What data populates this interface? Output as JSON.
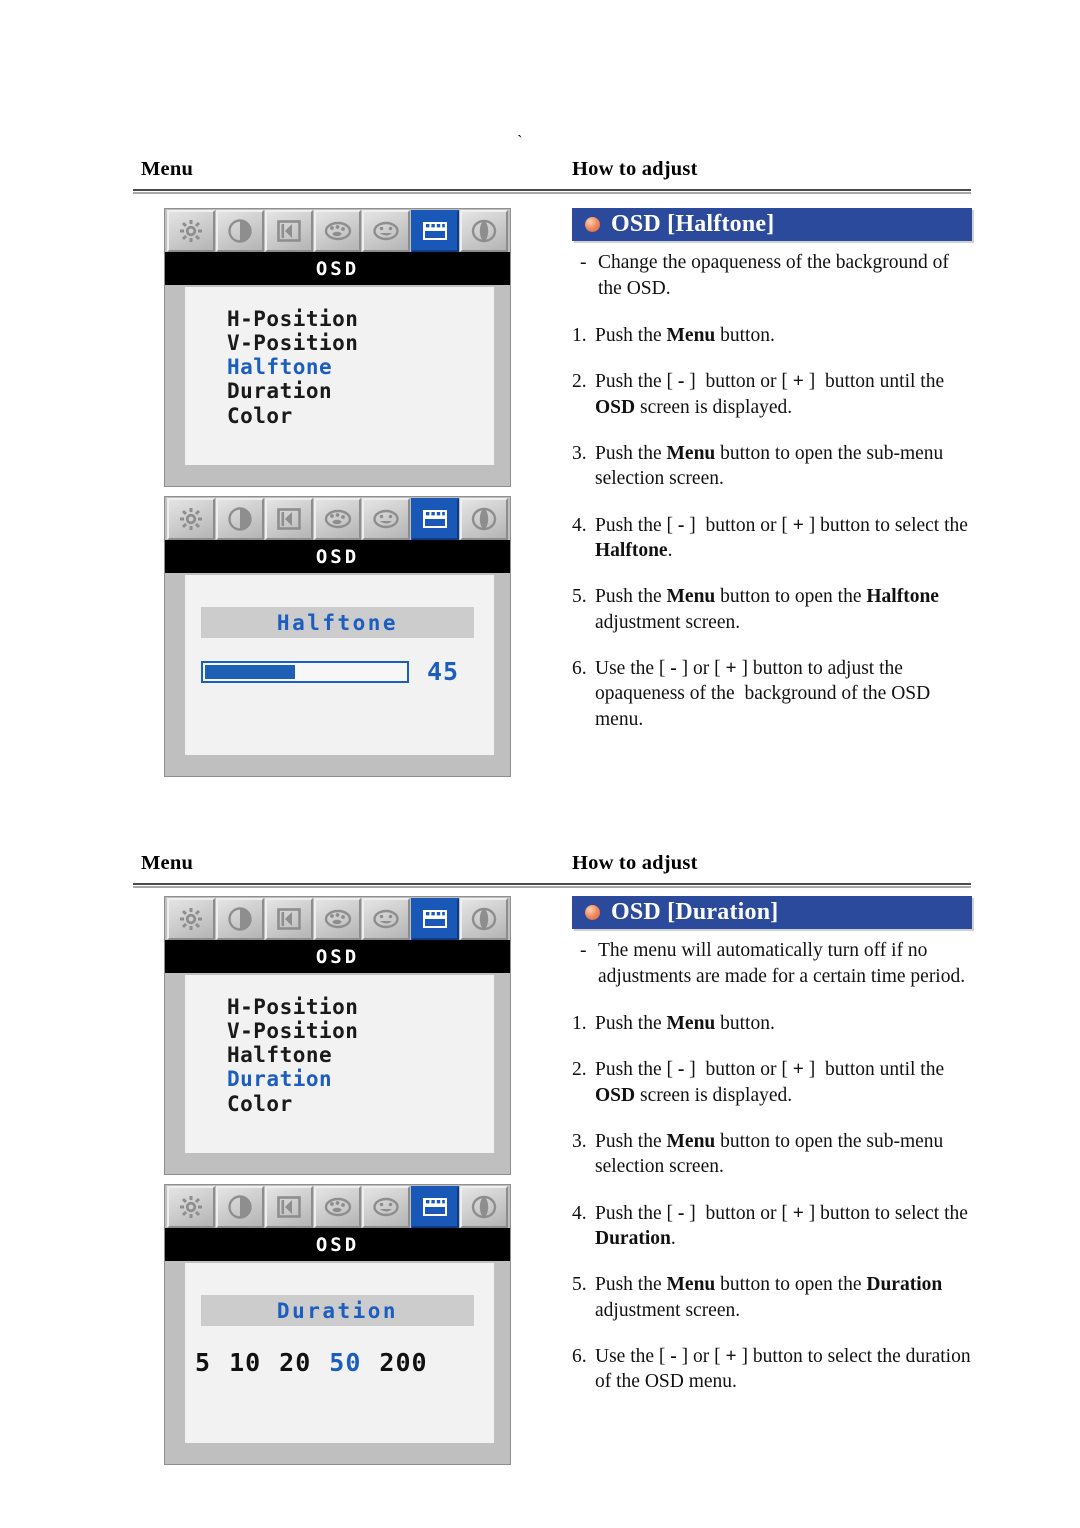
{
  "page": {
    "tick_mark": "`"
  },
  "columns": {
    "menu_header": "Menu",
    "howto_header": "How to adjust"
  },
  "icons": [
    "brightness-icon",
    "contrast-icon",
    "position-icon",
    "color-palette-icon",
    "smiley-icon",
    "osd-icon",
    "split-circle-icon"
  ],
  "sections": [
    {
      "id": "halftone",
      "osd_label": "OSD",
      "menu_items": [
        "H-Position",
        "V-Position",
        "Halftone",
        "Duration",
        "Color"
      ],
      "active_item": "Halftone",
      "adjust_label": "Halftone",
      "slider_value": "45",
      "slider_percent": 45,
      "title": "OSD [Halftone]",
      "description_dash": "-",
      "description": "Change the opaqueness of the background of the OSD.",
      "steps": [
        {
          "num": "1.",
          "html": "Push the <b>Menu</b> button."
        },
        {
          "num": "2.",
          "html": "Push the [ <b>-</b> ]&nbsp; button or [ <b>+</b> ]&nbsp; button until the <b>OSD</b> screen is displayed."
        },
        {
          "num": "3.",
          "html": "Push the <b>Menu</b> button to open the sub-menu selection screen."
        },
        {
          "num": "4.",
          "html": "Push the [ <b>-</b> ]&nbsp; button or [ <b>+</b> ] button to select the <b>Halftone</b>."
        },
        {
          "num": "5.",
          "html": "Push the <b>Menu</b> button to open the <b>Halftone</b> adjustment screen."
        },
        {
          "num": "6.",
          "html": "Use the [ <b>-</b> ] or [ <b>+</b> ] button to adjust the opaqueness of the&nbsp; background of the OSD menu."
        }
      ]
    },
    {
      "id": "duration",
      "osd_label": "OSD",
      "menu_items": [
        "H-Position",
        "V-Position",
        "Halftone",
        "Duration",
        "Color"
      ],
      "active_item": "Duration",
      "adjust_label": "Duration",
      "duration_options": [
        "5",
        "10",
        "20",
        "50",
        "200"
      ],
      "duration_selected": "50",
      "title": "OSD [Duration]",
      "description_dash": "-",
      "description": "The menu will automatically turn off if no adjustments are made for a certain time period.",
      "steps": [
        {
          "num": "1.",
          "html": "Push the <b>Menu</b> button."
        },
        {
          "num": "2.",
          "html": "Push the [ <b>-</b> ]&nbsp; button or [ <b>+</b> ]&nbsp; button until the <b>OSD</b> screen is displayed."
        },
        {
          "num": "3.",
          "html": "Push the <b>Menu</b> button to open the sub-menu selection screen."
        },
        {
          "num": "4.",
          "html": "Push the [ <b>-</b> ]&nbsp; button or [ <b>+</b> ] button to select the <b>Duration</b>."
        },
        {
          "num": "5.",
          "html": "Push the <b>Menu</b> button to open the <b>Duration</b> adjustment screen."
        },
        {
          "num": "6.",
          "html": "Use the [ <b>-</b> ] or [ <b>+</b> ] button to select the duration of the OSD menu."
        }
      ]
    }
  ],
  "colors": {
    "title_bar": "#2b4a9b",
    "osd_accent": "#1c5ec0",
    "panel_gray": "#bfbfbf",
    "screen": "#f2f2f2"
  }
}
